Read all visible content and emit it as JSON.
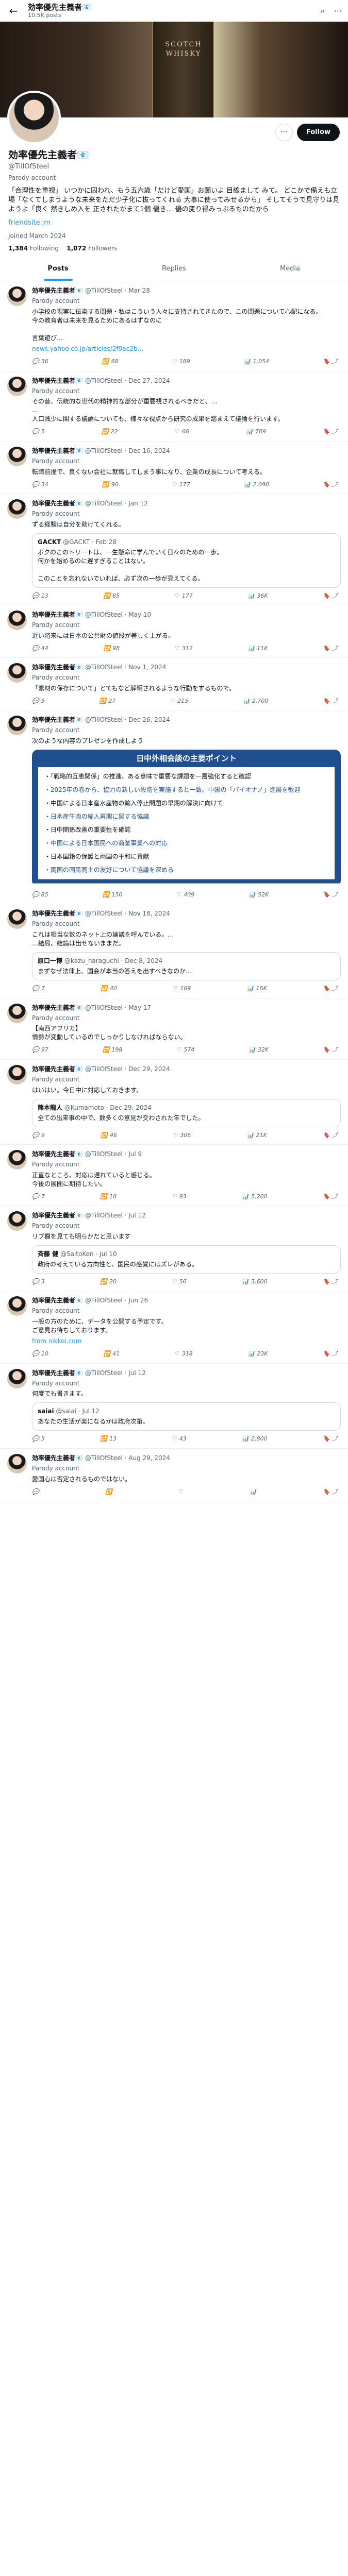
{
  "header": {
    "title": "効率優先主義者📧",
    "posts_count": "10.5K posts"
  },
  "banner_text": "SCOTCH WHISKY",
  "profile": {
    "name": "効率優先主義者📧",
    "handle": "@TillOfSteel",
    "parody": "Parody account",
    "bio": "「合理性を重視」 いつかに囚われ、もう五六歳「だけど愛国」お願いよ 目線まして みて。 どこかで備えも立場「なくてしまうような未来をただ少子化に抜ってくれる 大事に使ってみせるから」 そしてそうで見守りは見ようよ「良く 然きしめ入を 正されたがまて1個 優き… 優の変り得みっぷるものだから",
    "site": "friendsite.jm",
    "joined": "Joined March 2024",
    "following": "1,384",
    "followers": "1,072",
    "follow_label": "Follow"
  },
  "tabs": [
    "Posts",
    "Replies",
    "Media"
  ],
  "posts": [
    {
      "name": "効率優先主義者📧",
      "handle": "@TillOfSteel",
      "date": "Mar 28",
      "parody": "Parody account",
      "text": "小学校の現実に伝染する問題・私はこういう人々に支持されてきたので、この問題について心配になる。\n今の教育者は未来を見るためにあるはずなのに\n\n言葉遊び…",
      "link": "news.yahoo.co.jp/articles/2f9ac2b…",
      "stats": [
        "36",
        "68",
        "189",
        "1,054"
      ]
    },
    {
      "name": "効率優先主義者📧",
      "handle": "@TillOfSteel",
      "date": "Dec 27, 2024",
      "parody": "Parody account",
      "text": "その昔、伝統的な世代の精神的な部分が重要視されるべきだと、…\n…\n人口減少に関する議論についても、様々な視点から研究の成果を踏まえて議論を行います。",
      "stats": [
        "5",
        "22",
        "66",
        "789"
      ]
    },
    {
      "name": "効率優先主義者📧",
      "handle": "@TillOfSteel",
      "date": "Dec 16, 2024",
      "parody": "Parody account",
      "text": "転職前提で、良くない会社に就職してしまう事になり、企業の成長について考える。",
      "stats": [
        "34",
        "90",
        "177",
        "2,090"
      ]
    },
    {
      "name": "効率優先主義者📧",
      "handle": "@TillOfSteel",
      "date": "Jan 12",
      "parody": "Parody account",
      "text": "ずる経験は自分を助けてくれる。",
      "quote_name": "GACKT",
      "quote_handle": "@GACKT",
      "quote_date": "Feb 28",
      "quote_text": "ボクのこのトリートは、一生懸命に学んでいく日々のための一歩。\n何かを始めるのに遅すぎることはない。\n\nこのことを忘れないでいれば、必ず次の一歩が見えてくる。",
      "stats": [
        "13",
        "85",
        "177",
        "36K"
      ]
    },
    {
      "name": "効率優先主義者📧",
      "handle": "@TillOfSteel",
      "date": "May 10",
      "parody": "Parody account",
      "text": "近い将来には日本の公共財の値段が著しく上がる。",
      "stats": [
        "44",
        "98",
        "312",
        "11K"
      ]
    },
    {
      "name": "効率優先主義者📧",
      "handle": "@TillOfSteel",
      "date": "Nov 1, 2024",
      "parody": "Parody account",
      "text": "「素材の保存について」とてもなど解明されるような行動をするもので。",
      "stats": [
        "5",
        "27",
        "215",
        "2,700"
      ]
    },
    {
      "name": "効率優先主義者📧",
      "handle": "@TillOfSteel",
      "date": "Dec 26, 2024",
      "parody": "Parody account",
      "text": "次のような内容のプレゼンを作成しよう",
      "chart_title": "日中外相会談の主要ポイント",
      "chart_items": [
        "・「戦略的互恵関係」の推進、ある意味で重要な課題を一層強化すると確認",
        "・2025年の春から、協力の新しい段階を実施すると一致。中国の「バイオナノ」進展を歓迎",
        "・中国による日本産水産物の輸入停止問題の早期の解決に向けて",
        "・日本産牛肉の輸入再開に関する協議",
        "・日中関係改善の重要性を確認",
        "・中国による日本国民への商業事業への対応",
        "・日本国籍の保護と両国の平和に貢献",
        "・両国の国民同士の友好について協議を深める"
      ],
      "stats": [
        "85",
        "150",
        "409",
        "52K"
      ]
    },
    {
      "name": "効率優先主義者📧",
      "handle": "@TillOfSteel",
      "date": "Nov 18, 2024",
      "parody": "Parody account",
      "text": "これは相当な数のネット上の論議を呼んでいる。…\n…結局、結論は出せないままだ。",
      "quote_name": "原口一博",
      "quote_handle": "@kazu_haraguchi",
      "quote_date": "Dec 8, 2024",
      "quote_text": "まずなぜ法律上、国会が本当の答えを出すべきなのか…",
      "stats": [
        "7",
        "40",
        "169",
        "16K"
      ]
    },
    {
      "name": "効率優先主義者📧",
      "handle": "@TillOfSteel",
      "date": "May 17",
      "parody": "Parody account",
      "text": "【南西アフリカ】\n情勢が変動しているのでしっかりしなければならない。",
      "stats": [
        "97",
        "198",
        "574",
        "32K"
      ]
    },
    {
      "name": "効率優先主義者📧",
      "handle": "@TillOfSteel",
      "date": "Dec 29, 2024",
      "parody": "Parody account",
      "text": "はいはい。今日中に対応しておきます。",
      "quote_name": "熊本龍人",
      "quote_handle": "@Kumamoto",
      "quote_date": "Dec 29, 2024",
      "quote_text": "全ての出来事の中で、数多くの意見が交わされた年でした。",
      "stats": [
        "9",
        "46",
        "306",
        "21K"
      ]
    },
    {
      "name": "効率優先主義者📧",
      "handle": "@TillOfSteel",
      "date": "Jul 9",
      "parody": "Parody account",
      "text": "正直なところ、対応は遅れていると感じる。\n今後の展開に期待したい。",
      "stats": [
        "7",
        "18",
        "93",
        "5,200"
      ]
    },
    {
      "name": "効率優先主義者📧",
      "handle": "@TillOfSteel",
      "date": "Jul 12",
      "parody": "Parody account",
      "text": "リプ欄を見ても明らかだと思います",
      "quote_name": "斉藤 健",
      "quote_handle": "@SaitoKen",
      "quote_date": "Jul 10",
      "quote_text": "政府の考えている方向性と、国民の感覚にはズレがある。",
      "stats": [
        "3",
        "20",
        "56",
        "3,600"
      ]
    },
    {
      "name": "効率優先主義者📧",
      "handle": "@TillOfSteel",
      "date": "Jun 26",
      "parody": "Parody account",
      "text": "一般の方のために、データを公開する予定です。\nご意見お待ちしております。",
      "link": "from nikkei.com",
      "stats": [
        "10",
        "41",
        "318",
        "23K"
      ]
    },
    {
      "name": "効率優先主義者📧",
      "handle": "@TillOfSteel",
      "date": "Jul 12",
      "parody": "Parody account",
      "text": "何度でも書きます。",
      "quote_name": "saiai",
      "quote_handle": "@saiai",
      "quote_date": "Jul 12",
      "quote_text": "あなたの生活が楽になるかは政府次第。",
      "stats": [
        "5",
        "13",
        "43",
        "2,800"
      ]
    },
    {
      "name": "効率優先主義者📧",
      "handle": "@TillOfSteel",
      "date": "Aug 29, 2024",
      "parody": "Parody account",
      "text": "愛国心は否定されるものではない。",
      "stats": [
        "",
        "",
        "",
        ""
      ]
    }
  ]
}
